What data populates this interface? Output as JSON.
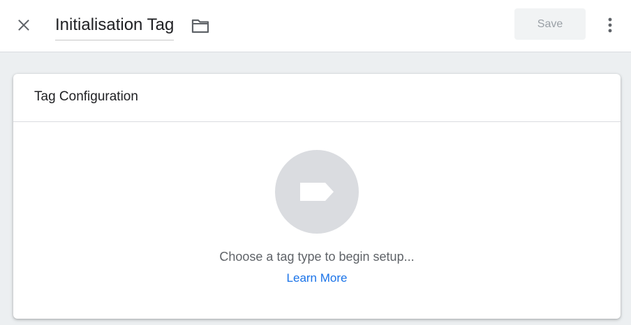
{
  "header": {
    "title": "Initialisation Tag",
    "save_label": "Save",
    "icons": {
      "close": "close-icon",
      "folder": "folder-icon",
      "more": "more-vert-icon"
    }
  },
  "card": {
    "title": "Tag Configuration",
    "placeholder_icon": "tag-icon",
    "hint": "Choose a tag type to begin setup...",
    "learn_more": "Learn More"
  },
  "colors": {
    "background": "#eceff1",
    "link": "#1a73e8",
    "save_disabled_bg": "#f1f3f4",
    "save_disabled_text": "#9aa0a6",
    "tag_circle": "#dadce0"
  }
}
